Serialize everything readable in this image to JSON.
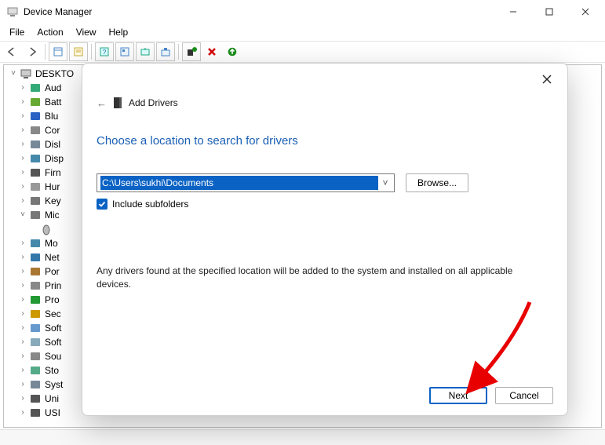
{
  "window": {
    "title": "Device Manager"
  },
  "menu": {
    "file": "File",
    "action": "Action",
    "view": "View",
    "help": "Help"
  },
  "tree": {
    "root": "DESKTO",
    "items": [
      {
        "label": "Aud",
        "expand": ">",
        "icon": "audio"
      },
      {
        "label": "Batt",
        "expand": ">",
        "icon": "battery"
      },
      {
        "label": "Blu",
        "expand": ">",
        "icon": "bluetooth"
      },
      {
        "label": "Cor",
        "expand": ">",
        "icon": "computer"
      },
      {
        "label": "Disl",
        "expand": ">",
        "icon": "disk"
      },
      {
        "label": "Disp",
        "expand": ">",
        "icon": "display"
      },
      {
        "label": "Firn",
        "expand": ">",
        "icon": "firmware"
      },
      {
        "label": "Hur",
        "expand": ">",
        "icon": "hid"
      },
      {
        "label": "Key",
        "expand": ">",
        "icon": "keyboard"
      },
      {
        "label": "Mic",
        "expand": "v",
        "icon": "mouse"
      },
      {
        "label": "Mo",
        "expand": ">",
        "icon": "monitor"
      },
      {
        "label": "Net",
        "expand": ">",
        "icon": "network"
      },
      {
        "label": "Por",
        "expand": ">",
        "icon": "port"
      },
      {
        "label": "Prin",
        "expand": ">",
        "icon": "printer"
      },
      {
        "label": "Pro",
        "expand": ">",
        "icon": "processor"
      },
      {
        "label": "Sec",
        "expand": ">",
        "icon": "security"
      },
      {
        "label": "Soft",
        "expand": ">",
        "icon": "software"
      },
      {
        "label": "Soft",
        "expand": ">",
        "icon": "software2"
      },
      {
        "label": "Sou",
        "expand": ">",
        "icon": "sound"
      },
      {
        "label": "Sto",
        "expand": ">",
        "icon": "storage"
      },
      {
        "label": "Syst",
        "expand": ">",
        "icon": "system"
      },
      {
        "label": "Uni",
        "expand": ">",
        "icon": "usb"
      },
      {
        "label": "USI",
        "expand": ">",
        "icon": "usb2"
      }
    ]
  },
  "dialog": {
    "breadcrumb": "Add Drivers",
    "heading": "Choose a location to search for drivers",
    "path_value": "C:\\Users\\sukhi\\Documents",
    "browse_label": "Browse...",
    "include_subfolders_label": "Include subfolders",
    "description": "Any drivers found at the specified location will be added to the system and installed on all applicable devices.",
    "next_label": "Next",
    "cancel_label": "Cancel"
  }
}
